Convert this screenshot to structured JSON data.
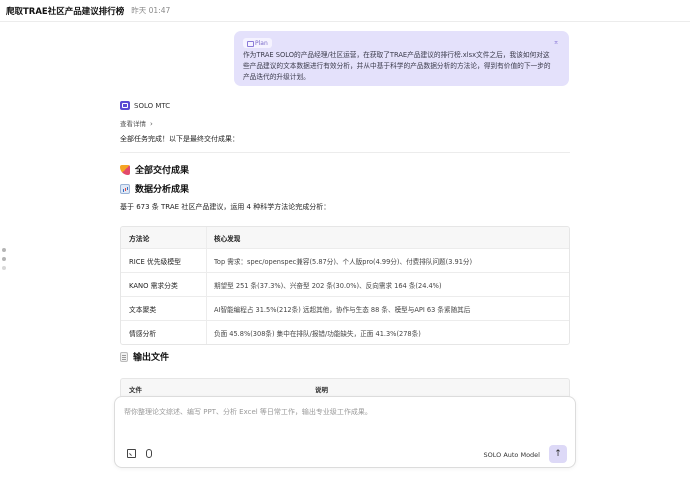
{
  "header": {
    "title": "爬取TRAE社区产品建议排行榜",
    "timestamp": "昨天 01:47"
  },
  "plan": {
    "badge": "Plan",
    "text": "作为TRAE SOLO的产品经理/社区运营，在获取了TRAE产品建议的排行榜.xlsx文件之后，我该如何对这些产品建议的文本数据进行有效分析，并从中基于科学的产品数据分析的方法论，得到有价值的下一步的产品迭代的升级计划。",
    "collapse_icon": "collapse-icon"
  },
  "agent": {
    "name": "SOLO MTC",
    "details_label": "查看详情",
    "done_text": "全部任务完成！以下是最终交付成果："
  },
  "sections": {
    "deliverables": "全部交付成果",
    "analysis": "数据分析成果",
    "summary": "基于 673 条 TRAE 社区产品建议，运用 4 种科学方法论完成分析：",
    "output_files": "输出文件"
  },
  "table": {
    "headers": [
      "方法论",
      "核心发现"
    ],
    "rows": [
      [
        "RICE 优先级模型",
        "Top 需求：spec/openspec兼容(5.87分)、个人版pro(4.99分)、付费排队问题(3.91分)"
      ],
      [
        "KANO 需求分类",
        "期望型 251 条(37.3%)、兴奋型 202 条(30.0%)、反向需求 164 条(24.4%)"
      ],
      [
        "文本聚类",
        "AI智能编程占 31.5%(212条) 远超其他，协作与生态 88 条、模型与API 63 条紧随其后"
      ],
      [
        "情感分析",
        "负面 45.8%(308条) 集中在排队/报错/功能缺失，正面 41.3%(278条)"
      ]
    ]
  },
  "table2": {
    "headers": [
      "文件",
      "说明"
    ]
  },
  "composer": {
    "placeholder": "帮你整理论文综述、编写 PPT、分析 Excel 等日常工作，输出专业级工作成果。",
    "model": "SOLO Auto Model"
  }
}
